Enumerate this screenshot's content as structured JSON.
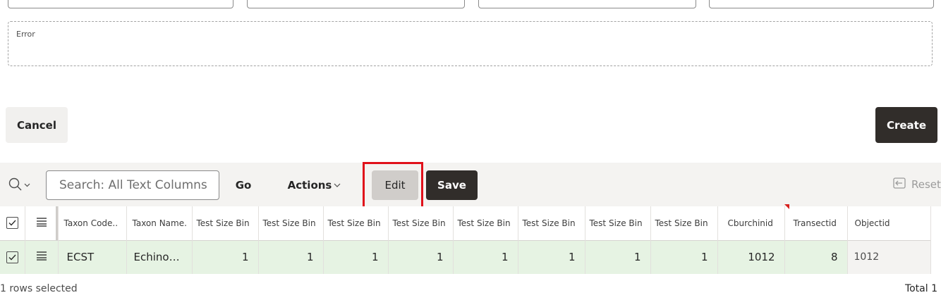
{
  "form": {
    "error_label": "Error",
    "cancel_label": "Cancel",
    "create_label": "Create"
  },
  "toolbar": {
    "search_placeholder": "Search: All Text Columns",
    "go_label": "Go",
    "actions_label": "Actions",
    "edit_label": "Edit",
    "save_label": "Save",
    "reset_label": "Reset"
  },
  "grid": {
    "columns": [
      "Taxon Code..",
      "Taxon Name.",
      "Test Size Bin",
      "Test Size Bin",
      "Test Size Bin",
      "Test Size Bin",
      "Test Size Bin",
      "Test Size Bin",
      "Test Size Bin",
      "Test Size Bin",
      "Cburchinid",
      "Transectid",
      "Objectid"
    ],
    "rows": [
      {
        "taxon_code": "ECST",
        "taxon_name": "Echino…",
        "bins": [
          "1",
          "1",
          "1",
          "1",
          "1",
          "1",
          "1",
          "1"
        ],
        "cburchinid": "1012",
        "transectid": "8",
        "objectid": "1012"
      }
    ]
  },
  "footer": {
    "status": "1 rows selected",
    "total": "Total 1"
  },
  "colors": {
    "primary_dark": "#312d2a",
    "selected_row": "#e6f3e3",
    "highlight": "#e0101a"
  }
}
